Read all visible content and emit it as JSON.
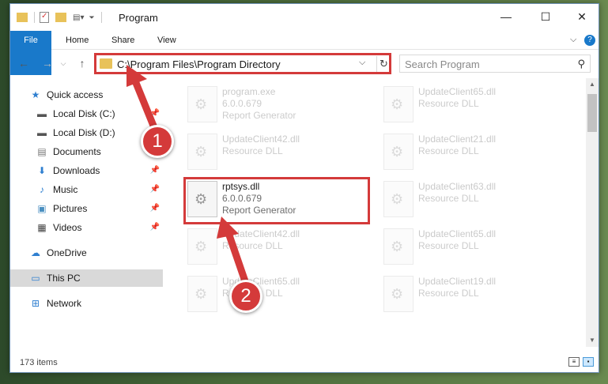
{
  "window": {
    "title": "Program",
    "controls": {
      "minimize": "—",
      "maximize": "☐",
      "close": "✕"
    }
  },
  "ribbon": {
    "tabs": [
      {
        "label": "File"
      },
      {
        "label": "Home"
      },
      {
        "label": "Share"
      },
      {
        "label": "View"
      }
    ]
  },
  "nav": {
    "address": "C:\\Program Files\\Program Directory",
    "search_placeholder": "Search Program"
  },
  "sidebar": {
    "items": [
      {
        "label": "Quick access",
        "icon": "star-icon",
        "pinned": false
      },
      {
        "label": "Local Disk (C:)",
        "icon": "drive-icon",
        "pinned": true
      },
      {
        "label": "Local Disk (D:)",
        "icon": "drive-icon",
        "pinned": false
      },
      {
        "label": "Documents",
        "icon": "documents-icon",
        "pinned": true
      },
      {
        "label": "Downloads",
        "icon": "download-icon",
        "pinned": true
      },
      {
        "label": "Music",
        "icon": "music-icon",
        "pinned": true
      },
      {
        "label": "Pictures",
        "icon": "pictures-icon",
        "pinned": true
      },
      {
        "label": "Videos",
        "icon": "videos-icon",
        "pinned": true
      },
      {
        "label": "OneDrive",
        "icon": "cloud-icon",
        "pinned": false
      },
      {
        "label": "This PC",
        "icon": "computer-icon",
        "pinned": false,
        "selected": true
      },
      {
        "label": "Network",
        "icon": "network-icon",
        "pinned": false
      }
    ]
  },
  "files": [
    {
      "name": "program.exe",
      "version": "6.0.0.679",
      "desc": "Report Generator",
      "faded": true
    },
    {
      "name": "UpdateClient65.dll",
      "version": "",
      "desc": "Resource DLL",
      "faded": true
    },
    {
      "name": "UpdateClient42.dll",
      "version": "",
      "desc": "Resource DLL",
      "faded": true
    },
    {
      "name": "UpdateClient21.dll",
      "version": "",
      "desc": "Resource DLL",
      "faded": true
    },
    {
      "name": "rptsys.dll",
      "version": "6.0.0.679",
      "desc": "Report Generator",
      "faded": false
    },
    {
      "name": "UpdateClient63.dll",
      "version": "",
      "desc": "Resource DLL",
      "faded": true
    },
    {
      "name": "UpdateClient42.dll",
      "version": "",
      "desc": "Resource DLL",
      "faded": true
    },
    {
      "name": "UpdateClient65.dll",
      "version": "",
      "desc": "Resource DLL",
      "faded": true
    },
    {
      "name": "UpdateClient65.dll",
      "version": "",
      "desc": "Resource DLL",
      "faded": true
    },
    {
      "name": "UpdateClient19.dll",
      "version": "",
      "desc": "Resource DLL",
      "faded": true
    }
  ],
  "status": {
    "items": "173 items"
  },
  "annotations": {
    "step1": "1",
    "step2": "2",
    "color": "#d43a3a"
  }
}
